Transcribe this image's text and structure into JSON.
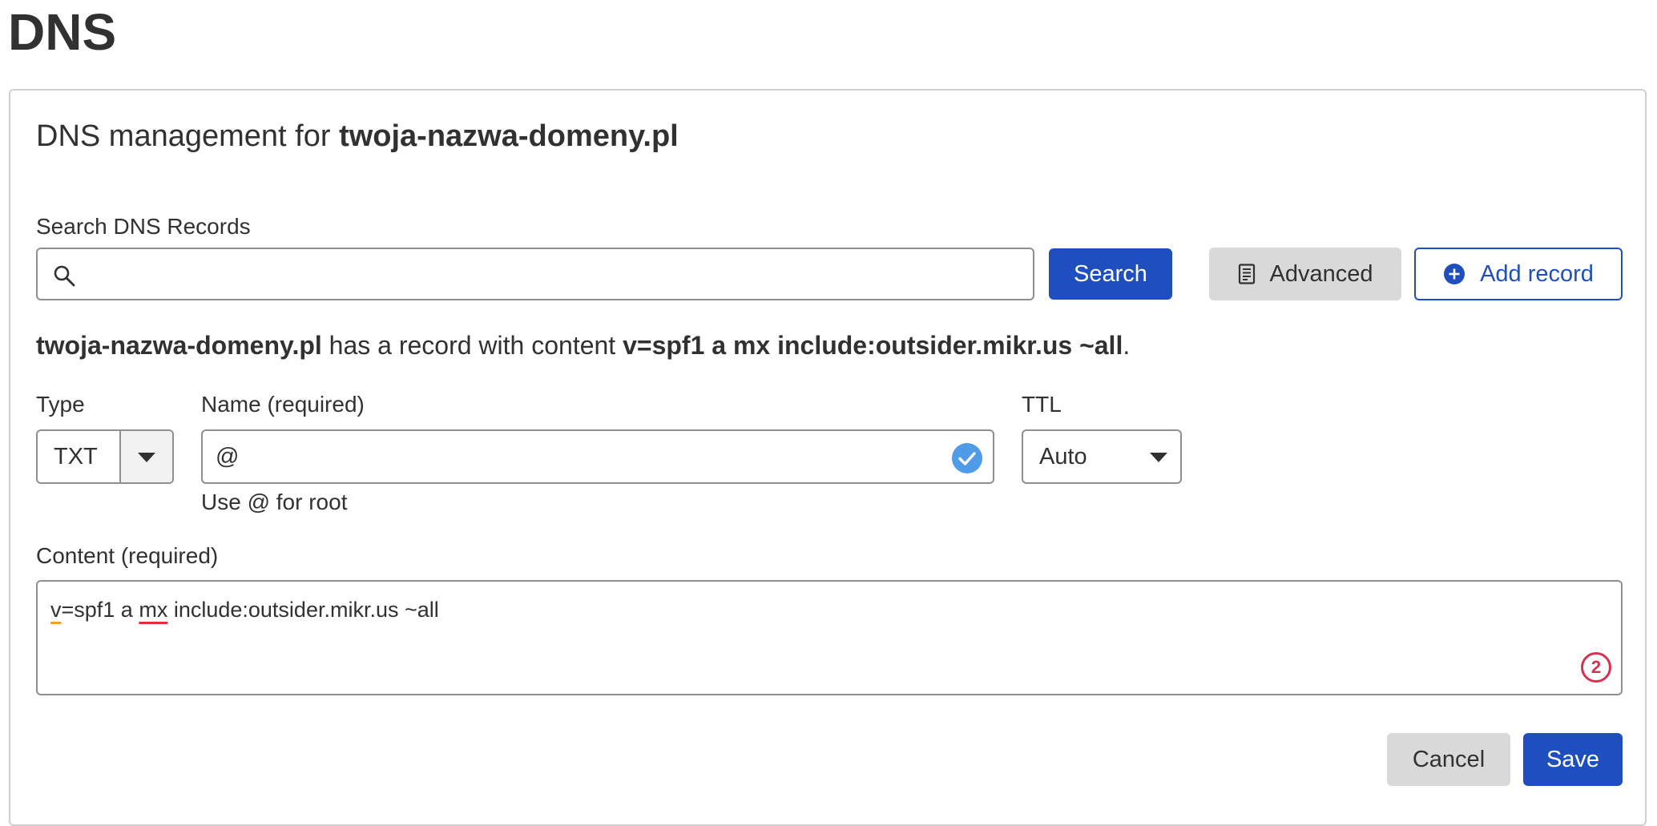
{
  "page": {
    "title": "DNS"
  },
  "card": {
    "heading_prefix": "DNS management for ",
    "heading_domain": "twoja-nazwa-domeny.pl"
  },
  "search": {
    "label": "Search DNS Records",
    "value": "",
    "placeholder": "",
    "button_label": "Search",
    "icon": "search-icon"
  },
  "toolbar": {
    "advanced_label": "Advanced",
    "advanced_icon": "document-icon",
    "add_record_label": "Add record",
    "add_record_icon": "plus-circle-icon"
  },
  "info": {
    "domain": "twoja-nazwa-domeny.pl",
    "middle": " has a record with content ",
    "content": "v=spf1 a mx include:outsider.mikr.us ~all",
    "end": "."
  },
  "form": {
    "type_label": "Type",
    "type_value": "TXT",
    "name_label": "Name (required)",
    "name_value": "@",
    "name_hint": "Use @ for root",
    "ttl_label": "TTL",
    "ttl_value": "Auto",
    "content_label": "Content (required)",
    "content_parts": [
      "v",
      "=spf1 a ",
      "mx",
      " include:outsider.mikr.us ~all"
    ],
    "content_badge": "2"
  },
  "actions": {
    "cancel_label": "Cancel",
    "save_label": "Save"
  },
  "colors": {
    "primary": "#1f4fbf",
    "grey_button": "#d9d9d9",
    "valid_check": "#4f9be8",
    "badge": "#d9304f"
  }
}
